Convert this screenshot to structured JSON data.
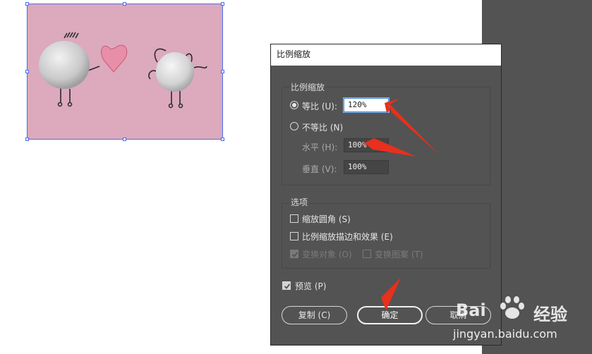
{
  "dialog": {
    "title": "比例缩放",
    "scale_group": {
      "title": "比例缩放",
      "uniform_label": "等比 (U):",
      "uniform_value": "120%",
      "non_uniform_label": "不等比 (N)",
      "horizontal_label": "水平 (H):",
      "horizontal_value": "100%",
      "vertical_label": "垂直 (V):",
      "vertical_value": "100%",
      "selected_option": "uniform"
    },
    "options_group": {
      "title": "选项",
      "scale_corners_label": "缩放圆角 (S)",
      "scale_corners_checked": false,
      "scale_strokes_label": "比例缩放描边和效果 (E)",
      "scale_strokes_checked": false,
      "transform_objects_label": "变换对象 (O)",
      "transform_objects_checked": true,
      "transform_patterns_label": "变换图案 (T)",
      "transform_patterns_checked": false
    },
    "preview_label": "预览 (P)",
    "preview_checked": true,
    "buttons": {
      "copy": "复制 (C)",
      "ok": "确定",
      "cancel": "取消"
    }
  },
  "watermark": {
    "logo_left": "Bai",
    "logo_right": "经验",
    "url": "jingyan.baidu.com"
  },
  "colors": {
    "dialog_bg": "#535353",
    "artwork_bg": "#dba6bb",
    "selection": "#4a6cf0",
    "arrow": "#e8301c"
  },
  "icons": [
    "radio-selected-icon",
    "radio-unselected-icon",
    "checkbox-icon",
    "checkmark-icon",
    "red-arrow-icon",
    "baidu-paw-icon"
  ]
}
